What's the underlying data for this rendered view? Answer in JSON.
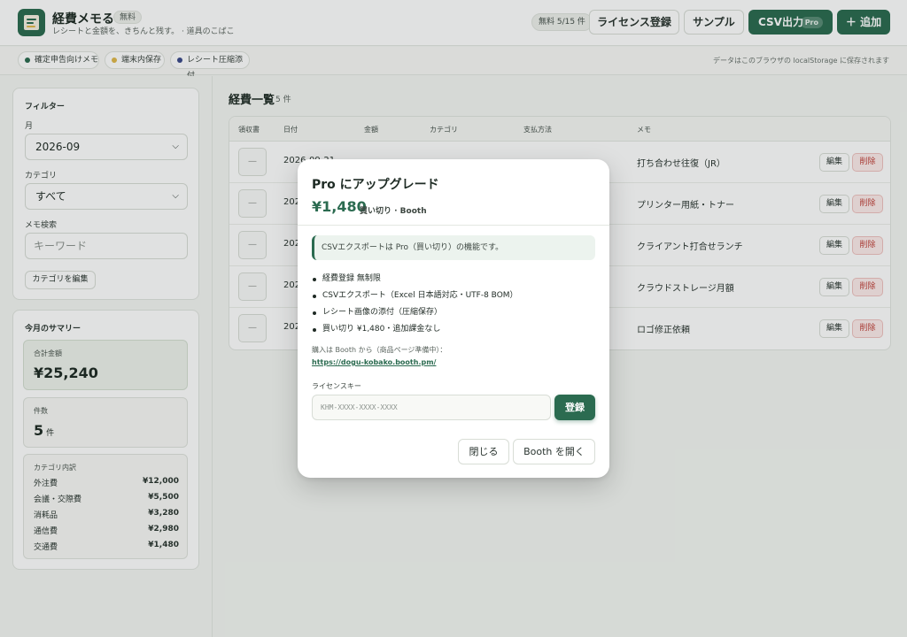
{
  "header": {
    "app_title": "経費メモる",
    "plan_badge": "無料",
    "subtitle": "レシートと金額を、きちんと残す。 · 道具のこばこ",
    "quota": "無料 5/15 件",
    "license_button": "ライセンス登録",
    "sample_button": "サンプル",
    "csv_button": "CSV出力",
    "csv_pro_badge": "Pro",
    "add_button": "＋ 追加"
  },
  "chips": [
    {
      "label": "確定申告向けメモ",
      "color": "#2b6b50"
    },
    {
      "label": "端末内保存",
      "color": "#e0b84b"
    },
    {
      "label": "レシート圧縮添付",
      "color": "#3b4a8a"
    }
  ],
  "storage_note": "データはこのブラウザの localStorage に保存されます",
  "filter": {
    "title": "フィルター",
    "month_label": "月",
    "month_value": "2026-09",
    "category_label": "カテゴリ",
    "category_value": "すべて",
    "memo_label": "メモ検索",
    "memo_placeholder": "キーワード",
    "edit_categories_button": "カテゴリを編集"
  },
  "summary": {
    "title": "今月のサマリー",
    "total_label": "合計金額",
    "total_value": "¥25,240",
    "count_label": "件数",
    "count_value": "5",
    "count_unit": "件",
    "breakdown_label": "カテゴリ内訳",
    "breakdown": [
      {
        "name": "外注費",
        "amount": "¥12,000"
      },
      {
        "name": "会議・交際費",
        "amount": "¥5,500"
      },
      {
        "name": "消耗品",
        "amount": "¥3,280"
      },
      {
        "name": "通信費",
        "amount": "¥2,980"
      },
      {
        "name": "交通費",
        "amount": "¥1,480"
      }
    ]
  },
  "list": {
    "title": "経費一覧",
    "count": "5 件",
    "columns": [
      "領収書",
      "日付",
      "金額",
      "カテゴリ",
      "支払方法",
      "メモ"
    ],
    "thumb_placeholder": "—",
    "edit_label": "編集",
    "delete_label": "削除",
    "rows": [
      {
        "date": "2026-09-21",
        "memo": "打ち合わせ往復（JR）"
      },
      {
        "date": "2026-09-18",
        "memo": "プリンター用紙・トナー"
      },
      {
        "date": "2026-09-14",
        "memo": "クライアント打合せランチ"
      },
      {
        "date": "2026-09-08",
        "memo": "クラウドストレージ月額"
      },
      {
        "date": "2026-09-03",
        "memo": "ロゴ修正依頼"
      }
    ]
  },
  "modal": {
    "title": "Pro にアップグレード",
    "price": "¥1,480",
    "price_note": "買い切り · Booth",
    "notice": "CSVエクスポートは Pro（買い切り）の機能です。",
    "features": [
      "経費登録 無制限",
      "CSVエクスポート（Excel 日本語対応・UTF-8 BOM）",
      "レシート画像の添付（圧縮保存）",
      "買い切り ¥1,480・追加課金なし"
    ],
    "buy_note": "購入は Booth から（商品ページ準備中）：",
    "buy_link": "https://dogu-kobako.booth.pm/",
    "license_label": "ライセンスキー",
    "license_placeholder": "KHM-XXXX-XXXX-XXXX",
    "register_button": "登録",
    "close_button": "閉じる",
    "booth_button": "Booth を開く"
  }
}
